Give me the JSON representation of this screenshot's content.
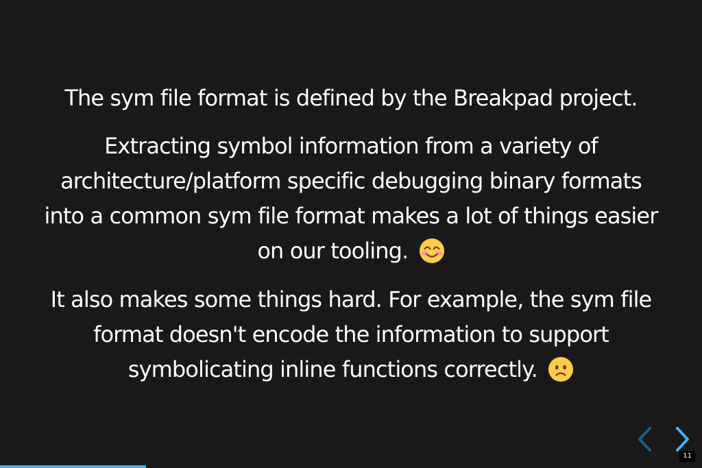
{
  "slide": {
    "paragraphs": [
      {
        "text": "The sym file format is defined by the Breakpad project.",
        "emoji": ""
      },
      {
        "text": "Extracting symbol information from a variety of architecture/platform specific debugging binary formats into a common sym file format makes a lot of things easier on our tooling.",
        "emoji": "smiling-face-icon"
      },
      {
        "text": "It also makes some things hard. For example, the sym file format doesn't encode the information to support symbolicating inline functions correctly.",
        "emoji": "frowning-face-icon"
      }
    ]
  },
  "controls": {
    "prev_icon": "chevron-left-icon",
    "next_icon": "chevron-right-icon",
    "slide_number": "11"
  },
  "progress": {
    "fraction": 0.208
  },
  "colors": {
    "background": "#191919",
    "text": "#ffffff",
    "accent": "#42affa",
    "prev_disabled": "#1f5c89"
  }
}
